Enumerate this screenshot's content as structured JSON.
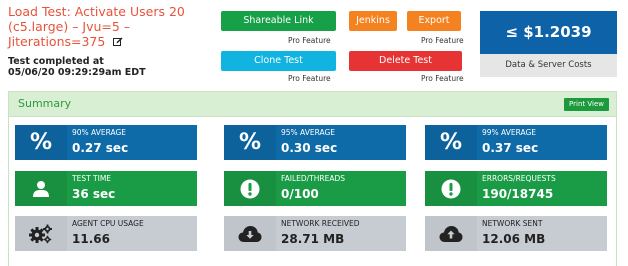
{
  "header": {
    "title": "Load Test: Activate Users 20 (c5.large) – Jvu=5 –Jiterations=375",
    "completed_label": "Test completed at",
    "completed_time": "05/06/20 09:29:29am EDT"
  },
  "actions": {
    "shareable_link": "Shareable Link",
    "jenkins": "Jenkins",
    "export": "Export",
    "clone_test": "Clone Test",
    "delete_test": "Delete Test",
    "pro_feature": "Pro Feature"
  },
  "cost": {
    "value": "≤ $1.2039",
    "label": "Data & Server Costs"
  },
  "summary": {
    "title": "Summary",
    "print_label": "Print View",
    "cards": [
      {
        "label": "90% AVERAGE",
        "value": "0.27 sec",
        "icon": "percent-icon"
      },
      {
        "label": "95% AVERAGE",
        "value": "0.30 sec",
        "icon": "percent-icon"
      },
      {
        "label": "99% AVERAGE",
        "value": "0.37 sec",
        "icon": "percent-icon"
      },
      {
        "label": "TEST TIME",
        "value": "36 sec",
        "icon": "user-icon"
      },
      {
        "label": "FAILED/THREADS",
        "value": "0/100",
        "icon": "alert-icon"
      },
      {
        "label": "ERRORS/REQUESTS",
        "value": "190/18745",
        "icon": "alert-icon"
      },
      {
        "label": "AGENT CPU USAGE",
        "value": "11.66",
        "icon": "gears-icon"
      },
      {
        "label": "NETWORK RECEIVED",
        "value": "28.71 MB",
        "icon": "cloud-download-icon"
      },
      {
        "label": "NETWORK SENT",
        "value": "12.06 MB",
        "icon": "cloud-upload-icon"
      }
    ]
  },
  "colors": {
    "title_red": "#e8533a",
    "cost_blue": "#0d62a8",
    "card_blue": "#0f6aa8",
    "card_green": "#1a9b45",
    "card_gray": "#c7ccd3",
    "summary_green": "#d8efd3"
  }
}
